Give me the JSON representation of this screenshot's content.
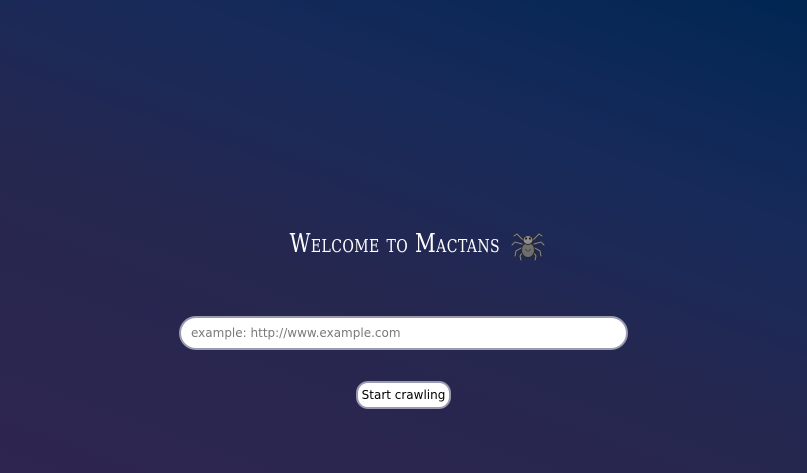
{
  "header": {
    "title": "Welcome to Mactans",
    "icon": "spider-icon"
  },
  "search": {
    "placeholder": "example: http://www.example.com",
    "value": ""
  },
  "actions": {
    "start_label": "Start crawling"
  },
  "colors": {
    "background_top_right": "#002652",
    "background_bottom_left": "#2e2550",
    "text": "#ffffff",
    "field_border": "#9a9ab0"
  }
}
